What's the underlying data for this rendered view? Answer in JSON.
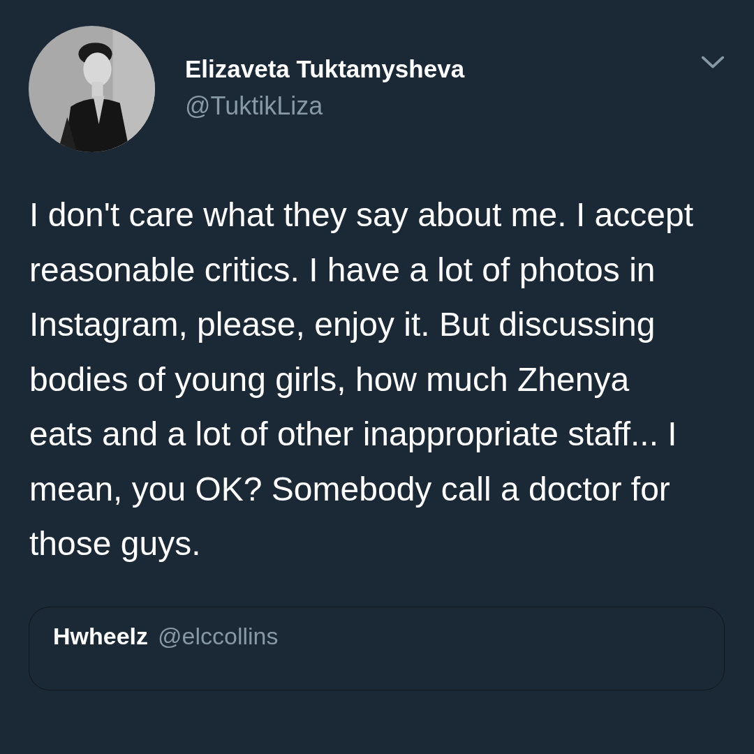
{
  "author": {
    "name": "Elizaveta Tuktamysheva",
    "handle": "@TuktikLiza"
  },
  "tweet": {
    "text": "I don't care what they say about me. I accept reasonable critics. I have a lot of photos in Instagram, please, enjoy it. But discussing bodies of young girls, how much Zhenya eats and a lot of other inappropriate staff... I mean, you OK? Somebody call a doctor for those guys."
  },
  "quoted_tweet": {
    "name": "Hwheelz",
    "handle": "@elccollins"
  }
}
